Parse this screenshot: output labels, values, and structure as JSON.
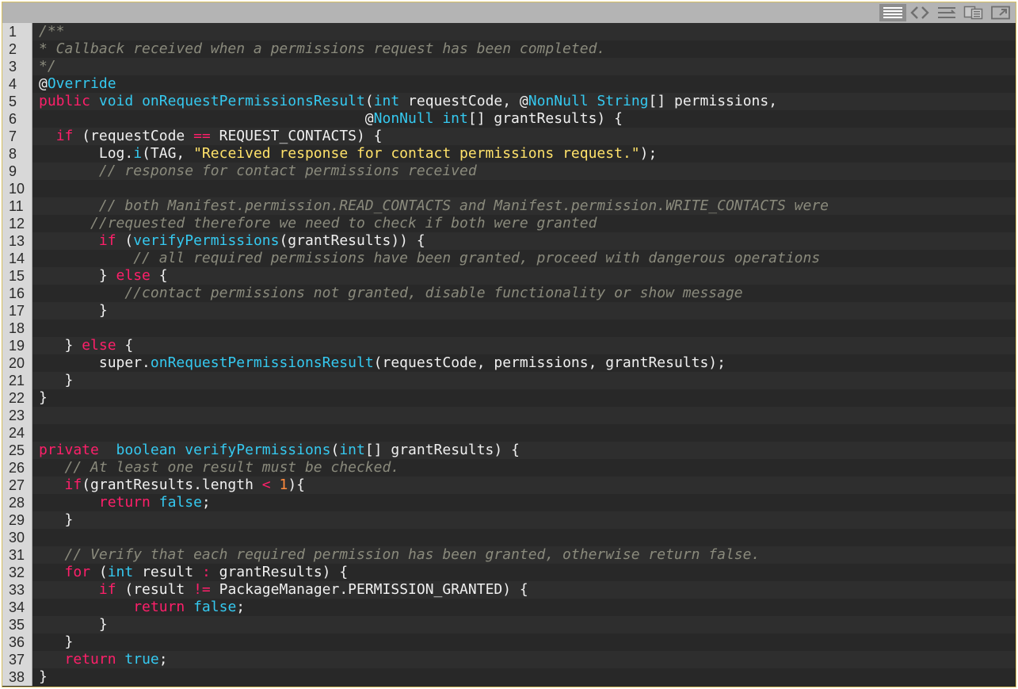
{
  "toolbar": {
    "buttons": [
      {
        "icon": "view-source-icon",
        "active": true
      },
      {
        "icon": "code-brackets-icon",
        "active": false
      },
      {
        "icon": "wrap-lines-icon",
        "active": false
      },
      {
        "icon": "copy-clipboard-icon",
        "active": false
      },
      {
        "icon": "open-new-window-icon",
        "active": false
      }
    ]
  },
  "lines": [
    [
      [
        "cm",
        "/**"
      ]
    ],
    [
      [
        "cm",
        "* Callback received when a permissions request has been completed."
      ]
    ],
    [
      [
        "cm",
        "*/"
      ]
    ],
    [
      [
        "p",
        "@"
      ],
      [
        "ty",
        "Override"
      ]
    ],
    [
      [
        "kw",
        "public"
      ],
      [
        "p",
        " "
      ],
      [
        "ty",
        "void"
      ],
      [
        "p",
        " "
      ],
      [
        "fn",
        "onRequestPermissionsResult"
      ],
      [
        "p",
        "("
      ],
      [
        "ty",
        "int"
      ],
      [
        "p",
        " requestCode, @"
      ],
      [
        "ty",
        "NonNull"
      ],
      [
        "p",
        " "
      ],
      [
        "ty",
        "String"
      ],
      [
        "p",
        "[] permissions,"
      ]
    ],
    [
      [
        "p",
        "                                      @"
      ],
      [
        "ty",
        "NonNull"
      ],
      [
        "p",
        " "
      ],
      [
        "ty",
        "int"
      ],
      [
        "p",
        "[] grantResults) {"
      ]
    ],
    [
      [
        "p",
        "  "
      ],
      [
        "kw",
        "if"
      ],
      [
        "p",
        " (requestCode "
      ],
      [
        "kw",
        "=="
      ],
      [
        "p",
        " REQUEST_CONTACTS) {"
      ]
    ],
    [
      [
        "p",
        "       Log."
      ],
      [
        "fn",
        "i"
      ],
      [
        "p",
        "(TAG, "
      ],
      [
        "str",
        "\"Received response for contact permissions request.\""
      ],
      [
        "p",
        ");"
      ]
    ],
    [
      [
        "p",
        "       "
      ],
      [
        "cm",
        "// response for contact permissions received"
      ]
    ],
    [
      [
        "p",
        ""
      ]
    ],
    [
      [
        "p",
        "       "
      ],
      [
        "cm",
        "// both Manifest.permission.READ_CONTACTS and Manifest.permission.WRITE_CONTACTS were"
      ]
    ],
    [
      [
        "p",
        "      "
      ],
      [
        "cm",
        "//requested therefore we need to check if both were granted"
      ]
    ],
    [
      [
        "p",
        "       "
      ],
      [
        "kw",
        "if"
      ],
      [
        "p",
        " ("
      ],
      [
        "fn",
        "verifyPermissions"
      ],
      [
        "p",
        "(grantResults)) {"
      ]
    ],
    [
      [
        "p",
        "           "
      ],
      [
        "cm",
        "// all required permissions have been granted, proceed with dangerous operations"
      ]
    ],
    [
      [
        "p",
        "       } "
      ],
      [
        "kw",
        "else"
      ],
      [
        "p",
        " {"
      ]
    ],
    [
      [
        "p",
        "          "
      ],
      [
        "cm",
        "//contact permissions not granted, disable functionality or show message"
      ]
    ],
    [
      [
        "p",
        "       }"
      ]
    ],
    [
      [
        "p",
        ""
      ]
    ],
    [
      [
        "p",
        "   } "
      ],
      [
        "kw",
        "else"
      ],
      [
        "p",
        " {"
      ]
    ],
    [
      [
        "p",
        "       super."
      ],
      [
        "fn",
        "onRequestPermissionsResult"
      ],
      [
        "p",
        "(requestCode, permissions, grantResults);"
      ]
    ],
    [
      [
        "p",
        "   }"
      ]
    ],
    [
      [
        "p",
        "}"
      ]
    ],
    [
      [
        "p",
        ""
      ]
    ],
    [
      [
        "p",
        ""
      ]
    ],
    [
      [
        "kw",
        "private"
      ],
      [
        "p",
        "  "
      ],
      [
        "ty",
        "boolean"
      ],
      [
        "p",
        " "
      ],
      [
        "fn",
        "verifyPermissions"
      ],
      [
        "p",
        "("
      ],
      [
        "ty",
        "int"
      ],
      [
        "p",
        "[] grantResults) {"
      ]
    ],
    [
      [
        "p",
        "   "
      ],
      [
        "cm",
        "// At least one result must be checked."
      ]
    ],
    [
      [
        "p",
        "   "
      ],
      [
        "kw",
        "if"
      ],
      [
        "p",
        "(grantResults.length "
      ],
      [
        "kw",
        "<"
      ],
      [
        "p",
        " "
      ],
      [
        "num",
        "1"
      ],
      [
        "p",
        "){"
      ]
    ],
    [
      [
        "p",
        "       "
      ],
      [
        "kw",
        "return"
      ],
      [
        "p",
        " "
      ],
      [
        "ty",
        "false"
      ],
      [
        "p",
        ";"
      ]
    ],
    [
      [
        "p",
        "   }"
      ]
    ],
    [
      [
        "p",
        ""
      ]
    ],
    [
      [
        "p",
        "   "
      ],
      [
        "cm",
        "// Verify that each required permission has been granted, otherwise return false."
      ]
    ],
    [
      [
        "p",
        "   "
      ],
      [
        "kw",
        "for"
      ],
      [
        "p",
        " ("
      ],
      [
        "ty",
        "int"
      ],
      [
        "p",
        " result "
      ],
      [
        "kw",
        ":"
      ],
      [
        "p",
        " grantResults) {"
      ]
    ],
    [
      [
        "p",
        "       "
      ],
      [
        "kw",
        "if"
      ],
      [
        "p",
        " (result "
      ],
      [
        "kw",
        "!="
      ],
      [
        "p",
        " PackageManager.PERMISSION_GRANTED) {"
      ]
    ],
    [
      [
        "p",
        "           "
      ],
      [
        "kw",
        "return"
      ],
      [
        "p",
        " "
      ],
      [
        "ty",
        "false"
      ],
      [
        "p",
        ";"
      ]
    ],
    [
      [
        "p",
        "       }"
      ]
    ],
    [
      [
        "p",
        "   }"
      ]
    ],
    [
      [
        "p",
        "   "
      ],
      [
        "kw",
        "return"
      ],
      [
        "p",
        " "
      ],
      [
        "ty",
        "true"
      ],
      [
        "p",
        ";"
      ]
    ],
    [
      [
        "p",
        "}"
      ]
    ]
  ]
}
